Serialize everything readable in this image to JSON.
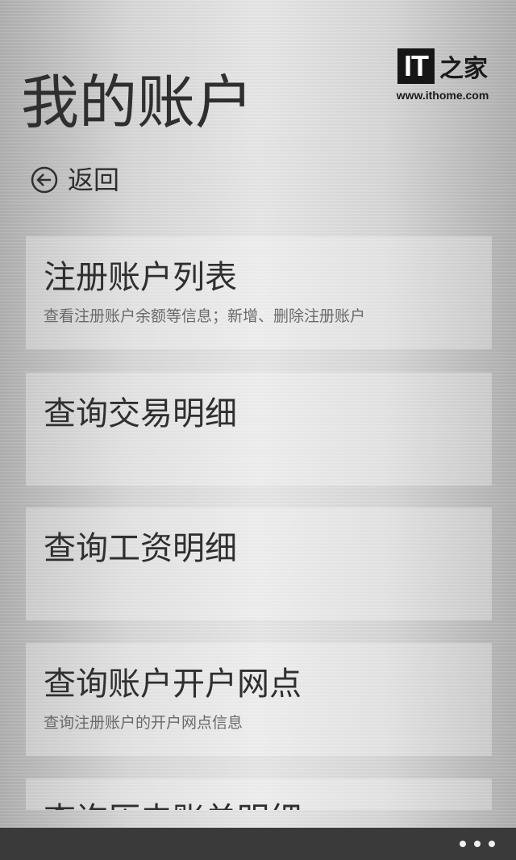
{
  "watermark": {
    "logo_text": "IT",
    "logo_cn": "之家",
    "url": "www.ithome.com"
  },
  "page": {
    "title": "我的账户"
  },
  "back": {
    "icon": "back-arrow-circle-icon",
    "label": "返回"
  },
  "menu": {
    "items": [
      {
        "title": "注册账户列表",
        "subtitle": "查看注册账户余额等信息；新增、删除注册账户"
      },
      {
        "title": "查询交易明细",
        "subtitle": ""
      },
      {
        "title": "查询工资明细",
        "subtitle": ""
      },
      {
        "title": "查询账户开户网点",
        "subtitle": "查询注册账户的开户网点信息"
      },
      {
        "title": "查询历史账单明细",
        "subtitle": ""
      }
    ]
  },
  "app_bar": {
    "more_icon": "more-dots-icon"
  },
  "colors": {
    "text_primary": "#2f2f2f",
    "text_secondary": "#6a6a6a",
    "app_bar": "#3a3a3a"
  }
}
